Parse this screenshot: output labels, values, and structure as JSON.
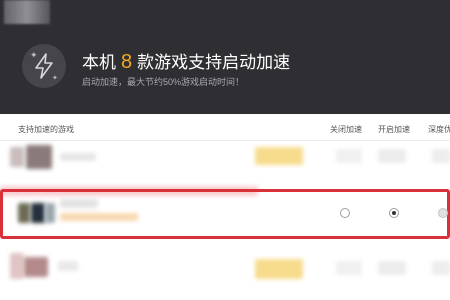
{
  "header": {
    "title_prefix": "本机",
    "title_count": "8",
    "title_suffix": "款游戏支持启动加速",
    "subtitle": "启动加速，最大节约50%游戏启动时间！",
    "accent_color": "#f5a623",
    "badge_icon": "lightning-icon"
  },
  "table": {
    "columns": {
      "game": "支持加速的游戏",
      "off": "关闭加速",
      "on": "开启加速",
      "deep": "深度优"
    },
    "rows": [
      {
        "selected": "none"
      },
      {
        "selected": "on"
      },
      {
        "selected": "none"
      }
    ]
  },
  "highlight_color": "#d9313a"
}
